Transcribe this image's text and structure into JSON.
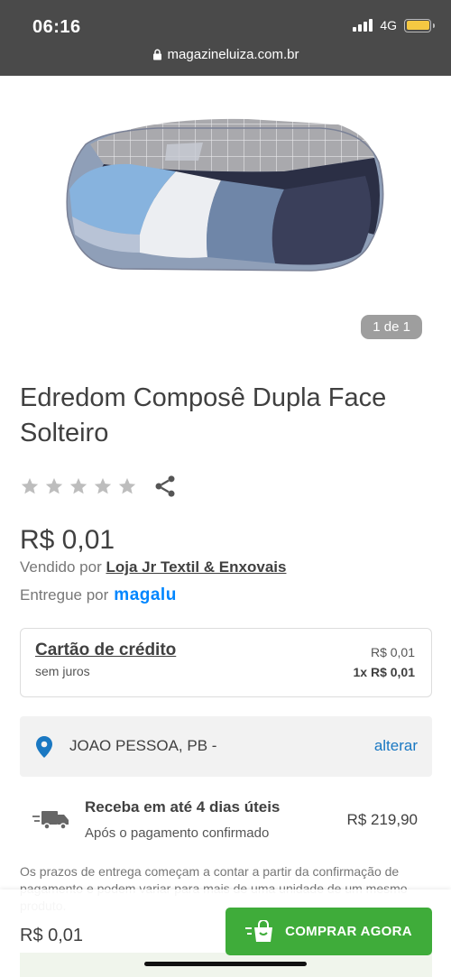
{
  "status_bar": {
    "time": "06:16",
    "network": "4G",
    "url": "magazineluiza.com.br",
    "icons": [
      "signal-icon",
      "battery-icon",
      "lock-icon"
    ]
  },
  "gallery": {
    "counter": "1 de 1"
  },
  "product": {
    "title": "Edredom Composê Dupla Face Solteiro",
    "rating_stars": 5,
    "rating_filled": 0,
    "price": "R$ 0,01",
    "sold_by_prefix": "Vendido por",
    "seller": "Loja Jr Textil & Enxovais",
    "delivered_by_prefix": "Entregue por",
    "delivered_by_brand": "magalu"
  },
  "payment": {
    "title": "Cartão de crédito",
    "subtitle": "sem juros",
    "total": "R$ 0,01",
    "installment": "1x R$ 0,01"
  },
  "location": {
    "city": "JOAO PESSOA, PB -",
    "change_label": "alterar"
  },
  "shipping": {
    "title": "Receba em até 4 dias úteis",
    "subtitle": "Após o pagamento confirmado",
    "price": "R$ 219,90"
  },
  "disclaimer": "Os prazos de entrega começam a contar a partir da confirmação de pagamento e podem variar para mais de uma unidade de um mesmo produto.",
  "bottom_bar": {
    "price": "R$ 0,01",
    "buy_label": "COMPRAR AGORA"
  },
  "colors": {
    "status_bar": "#4a4a4a",
    "accent_link": "#1a78c2",
    "brand_blue": "#0086ff",
    "buy_green": "#3fac3a"
  }
}
